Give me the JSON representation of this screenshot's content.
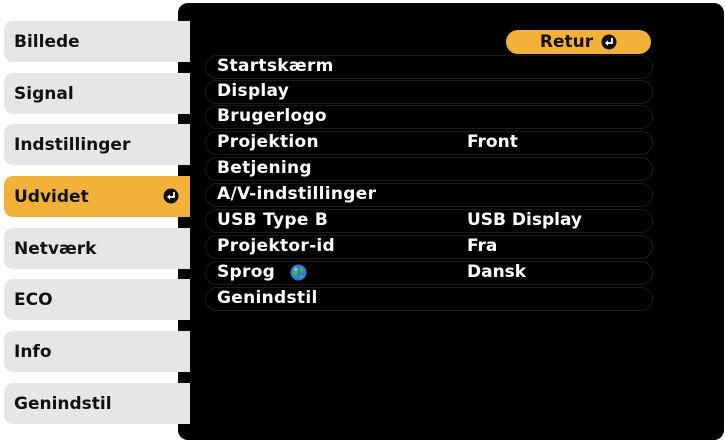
{
  "tabs": [
    {
      "label": "Billede"
    },
    {
      "label": "Signal"
    },
    {
      "label": "Indstillinger"
    },
    {
      "label": "Udvidet",
      "active": true
    },
    {
      "label": "Netværk"
    },
    {
      "label": "ECO"
    },
    {
      "label": "Info"
    },
    {
      "label": "Genindstil"
    }
  ],
  "return_button": {
    "label": "Retur",
    "icon": "enter-icon"
  },
  "menu": [
    {
      "label": "Startskærm",
      "value": ""
    },
    {
      "label": "Display",
      "value": ""
    },
    {
      "label": "Brugerlogo",
      "value": ""
    },
    {
      "label": "Projektion",
      "value": "Front"
    },
    {
      "label": "Betjening",
      "value": ""
    },
    {
      "label": "A/V-indstillinger",
      "value": ""
    },
    {
      "label": "USB Type B",
      "value": "USB Display"
    },
    {
      "label": "Projektor-id",
      "value": "Fra"
    },
    {
      "label": "Sprog",
      "value": "Dansk",
      "icon": "globe-icon"
    },
    {
      "label": "Genindstil",
      "value": ""
    }
  ],
  "colors": {
    "accent": "#f2b23a",
    "tab_bg": "#e6e6e6",
    "panel_bg": "#000000",
    "text_light": "#ffffff"
  }
}
